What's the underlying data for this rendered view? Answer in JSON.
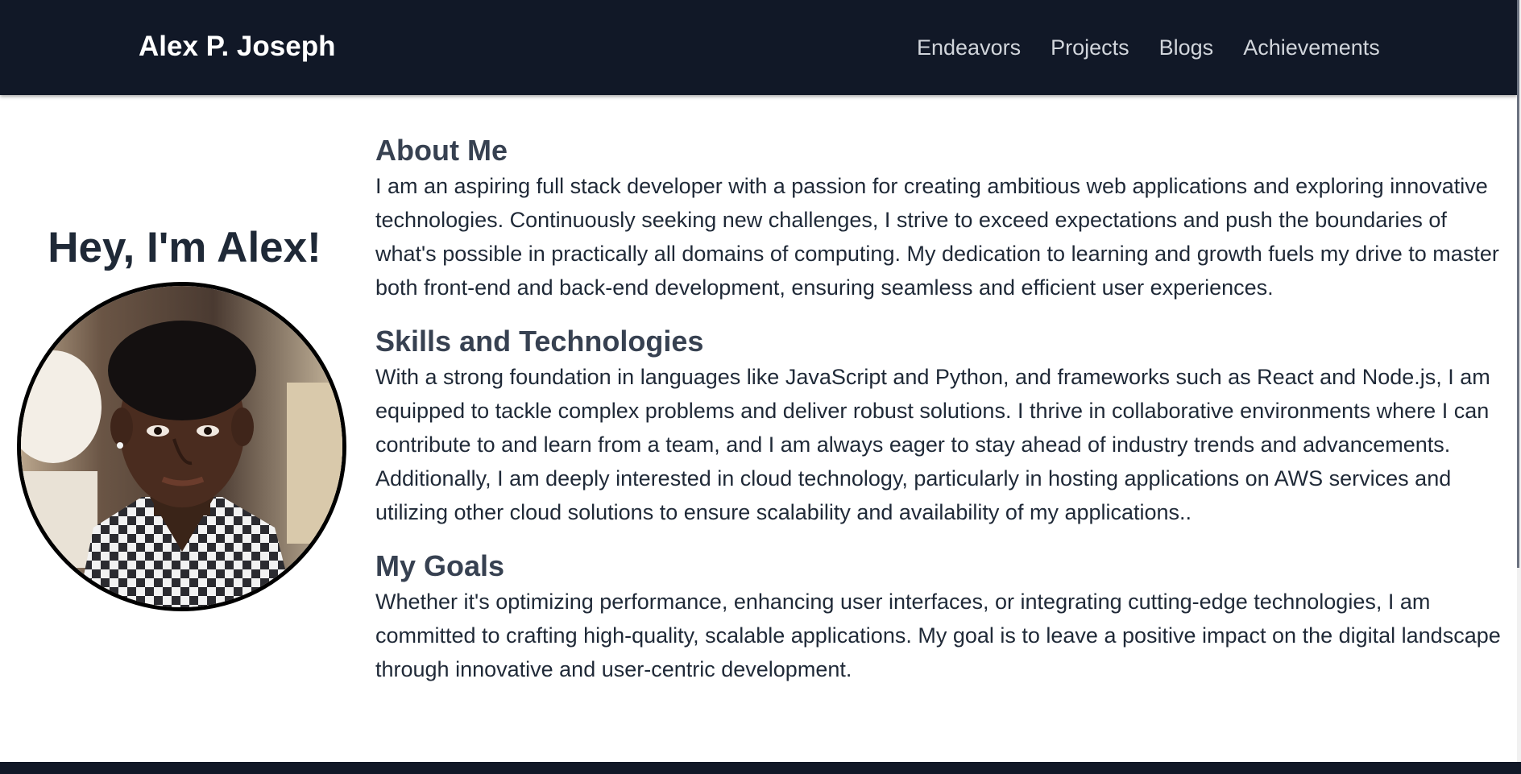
{
  "nav": {
    "brand": "Alex P. Joseph",
    "links": [
      "Endeavors",
      "Projects",
      "Blogs",
      "Achievements"
    ]
  },
  "hero": {
    "title": "Hey, I'm Alex!",
    "avatar_alt": "profile-photo"
  },
  "sections": [
    {
      "heading": "About Me",
      "text": "I am an aspiring full stack developer with a passion for creating ambitious web applications and exploring innovative technologies. Continuously seeking new challenges, I strive to exceed expectations and push the boundaries of what's possible in practically all domains of computing. My dedication to learning and growth fuels my drive to master both front-end and back-end development, ensuring seamless and efficient user experiences."
    },
    {
      "heading": "Skills and Technologies",
      "text": "With a strong foundation in languages like JavaScript and Python, and frameworks such as React and Node.js, I am equipped to tackle complex problems and deliver robust solutions. I thrive in collaborative environments where I can contribute to and learn from a team, and I am always eager to stay ahead of industry trends and advancements. Additionally, I am deeply interested in cloud technology, particularly in hosting applications on AWS services and utilizing other cloud solutions to ensure scalability and availability of my applications.."
    },
    {
      "heading": "My Goals",
      "text": "Whether it's optimizing performance, enhancing user interfaces, or integrating cutting-edge technologies, I am committed to crafting high-quality, scalable applications. My goal is to leave a positive impact on the digital landscape through innovative and user-centric development."
    }
  ],
  "colors": {
    "navbar_bg": "#111827",
    "heading": "#374151",
    "body_text": "#1f2937"
  }
}
